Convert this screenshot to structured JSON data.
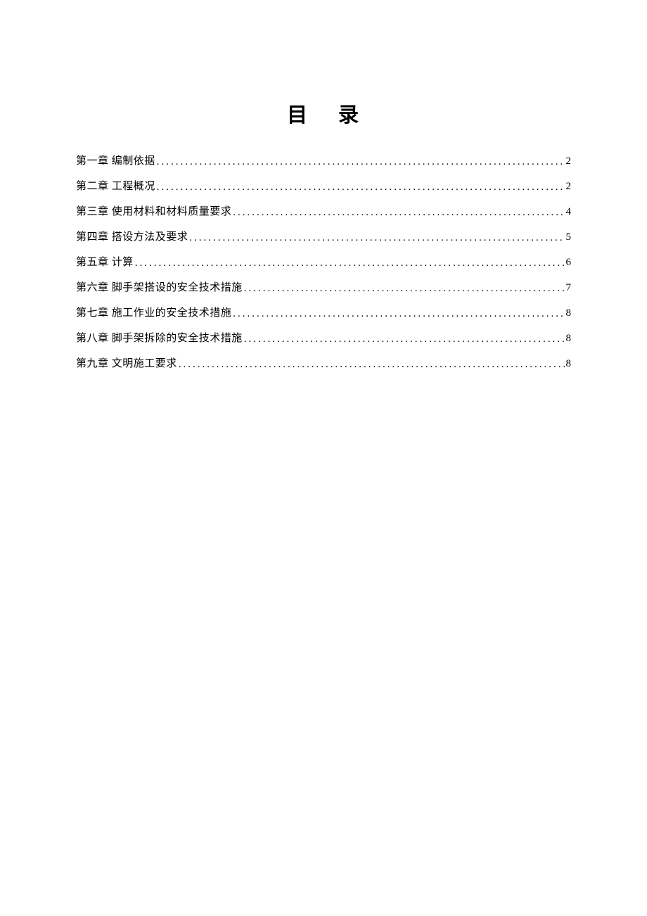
{
  "title_char1": "目",
  "title_char2": "录",
  "toc": [
    {
      "label": "第一章 编制依据",
      "page": "2"
    },
    {
      "label": "第二章 工程概况",
      "page": "2"
    },
    {
      "label": "第三章 使用材料和材料质量要求",
      "page": "4"
    },
    {
      "label": "第四章 搭设方法及要求",
      "page": "5"
    },
    {
      "label": "第五章 计算",
      "page": "6"
    },
    {
      "label": "第六章 脚手架搭设的安全技术措施",
      "page": "7"
    },
    {
      "label": "第七章 施工作业的安全技术措施",
      "page": "8"
    },
    {
      "label": "第八章 脚手架拆除的安全技术措施",
      "page": "8"
    },
    {
      "label": "第九章 文明施工要求",
      "page": "8"
    }
  ]
}
